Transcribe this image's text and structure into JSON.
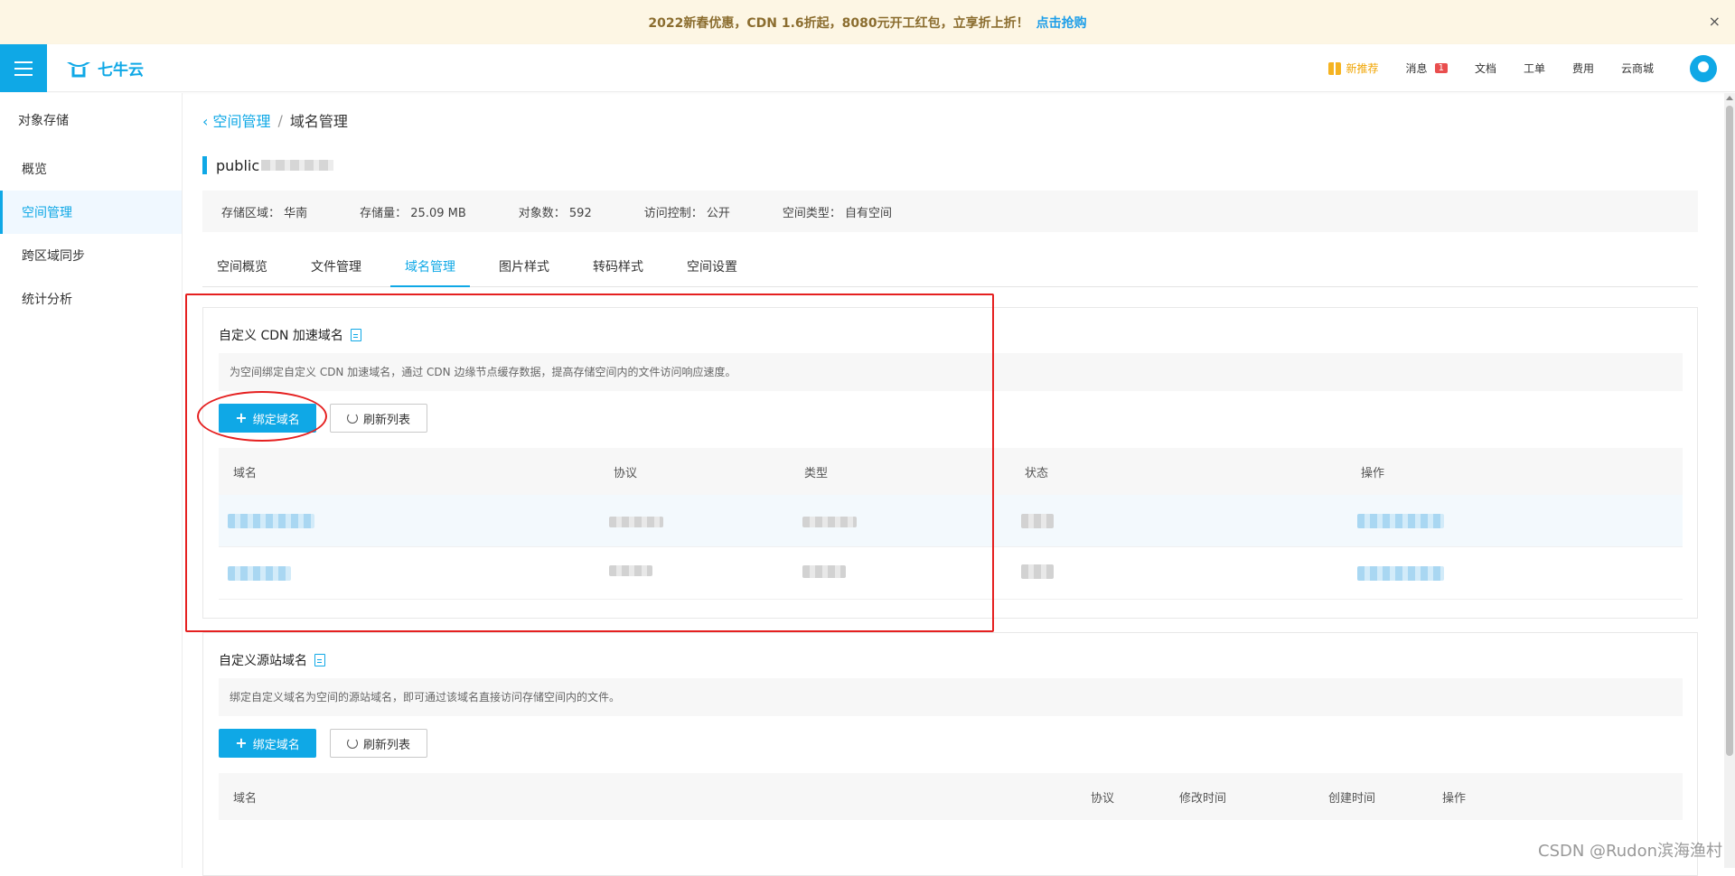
{
  "promo": {
    "text": "2022新春优惠，CDN 1.6折起，8080元开工红包，立享折上折！",
    "link": "点击抢购",
    "close": "×"
  },
  "topbar": {
    "logo_text": "七牛云",
    "nav": {
      "new_rec": "新推荐",
      "messages": "消息",
      "messages_badge": "1",
      "docs": "文档",
      "tickets": "工单",
      "billing": "费用",
      "mall": "云商城"
    }
  },
  "sidebar": {
    "section_title": "对象存储",
    "items": [
      {
        "label": "概览"
      },
      {
        "label": "空间管理"
      },
      {
        "label": "跨区域同步"
      },
      {
        "label": "统计分析"
      }
    ]
  },
  "breadcrumb": {
    "back": "空间管理",
    "sep": "/",
    "current": "域名管理"
  },
  "bucket": {
    "name_prefix": "public"
  },
  "info": {
    "region": "存储区域： 华南",
    "storage": "存储量： 25.09 MB",
    "objects": "对象数： 592",
    "access": "访问控制： 公开",
    "type": "空间类型： 自有空间"
  },
  "tabs": [
    {
      "label": "空间概览"
    },
    {
      "label": "文件管理"
    },
    {
      "label": "域名管理"
    },
    {
      "label": "图片样式"
    },
    {
      "label": "转码样式"
    },
    {
      "label": "空间设置"
    }
  ],
  "cdn_panel": {
    "title": "自定义 CDN 加速域名",
    "desc": "为空间绑定自定义 CDN 加速域名，通过 CDN 边缘节点缓存数据，提高存储空间内的文件访问响应速度。",
    "bind_button": "绑定域名",
    "refresh_button": "刷新列表",
    "columns": [
      "域名",
      "协议",
      "类型",
      "状态",
      "操作"
    ]
  },
  "origin_panel": {
    "title": "自定义源站域名",
    "desc": "绑定自定义域名为空间的源站域名，即可通过该域名直接访问存储空间内的文件。",
    "bind_button": "绑定域名",
    "refresh_button": "刷新列表",
    "columns": [
      "域名",
      "协议",
      "修改时间",
      "创建时间",
      "操作"
    ]
  },
  "watermark": "CSDN @Rudon滨海渔村",
  "colors": {
    "accent": "#0fa8e6",
    "annotation": "#e52020"
  }
}
